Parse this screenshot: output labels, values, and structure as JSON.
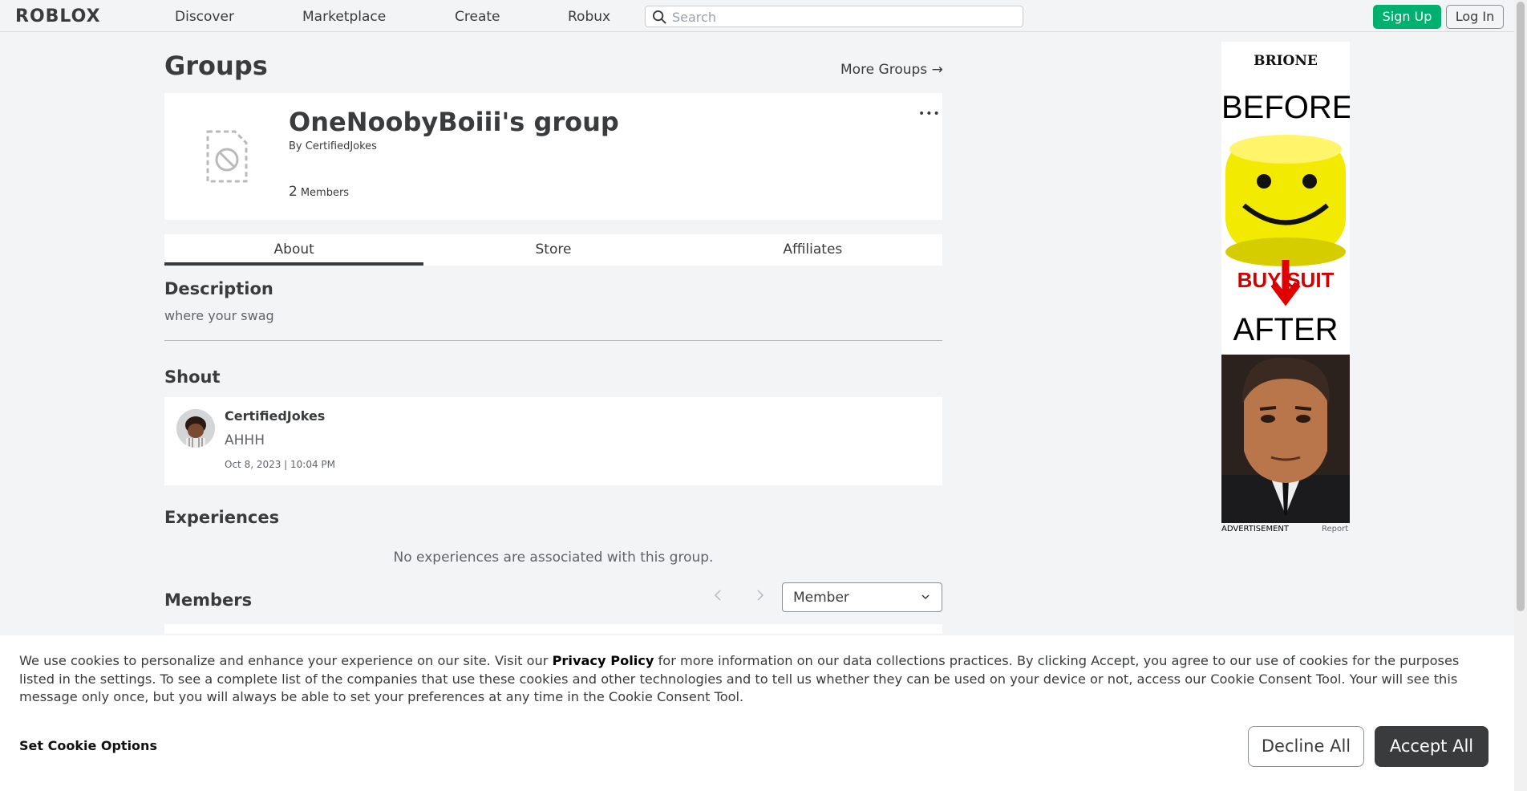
{
  "nav": {
    "logo": "ROBLOX",
    "links": [
      "Discover",
      "Marketplace",
      "Create",
      "Robux"
    ],
    "search_placeholder": "Search",
    "signup": "Sign Up",
    "login": "Log In"
  },
  "header": {
    "title": "Groups",
    "more_groups": "More Groups →"
  },
  "group": {
    "name": "OneNoobyBoiii's group",
    "owner_prefix": "By",
    "owner": "CertifiedJokes",
    "members_count": "2",
    "members_label": "Members",
    "more_menu": "•••"
  },
  "tabs": [
    "About",
    "Store",
    "Affiliates"
  ],
  "about": {
    "description_title": "Description",
    "description": "where your swag",
    "shout_title": "Shout",
    "shout": {
      "user": "CertifiedJokes",
      "text": "AHHH",
      "time": "Oct 8, 2023 | 10:04 PM"
    },
    "experiences_title": "Experiences",
    "no_experiences": "No experiences are associated with this group.",
    "members_title": "Members",
    "role_select": "Member"
  },
  "ad": {
    "brand": "BRIONE",
    "before": "BEFORE",
    "buy": "BUY SUIT",
    "after": "AFTER",
    "label": "ADVERTISEMENT",
    "report": "Report"
  },
  "cookie": {
    "text_before": "We use cookies to personalize and enhance your experience on our site. Visit our ",
    "privacy_link": "Privacy Policy",
    "text_after": " for more information on our data collections practices. By clicking Accept, you agree to our use of cookies for the purposes listed in the settings. To see a complete list of the companies that use these cookies and other technologies and to tell us whether they can be used on your device or not, access our Cookie Consent Tool. Your will see this message only once, but you will always be able to set your preferences at any time in the Cookie Consent Tool.",
    "options": "Set Cookie Options",
    "decline": "Decline All",
    "accept": "Accept All"
  },
  "colors": {
    "accent_green": "#00b06f",
    "text_dark": "#393b3d",
    "background": "#f2f4f5"
  }
}
